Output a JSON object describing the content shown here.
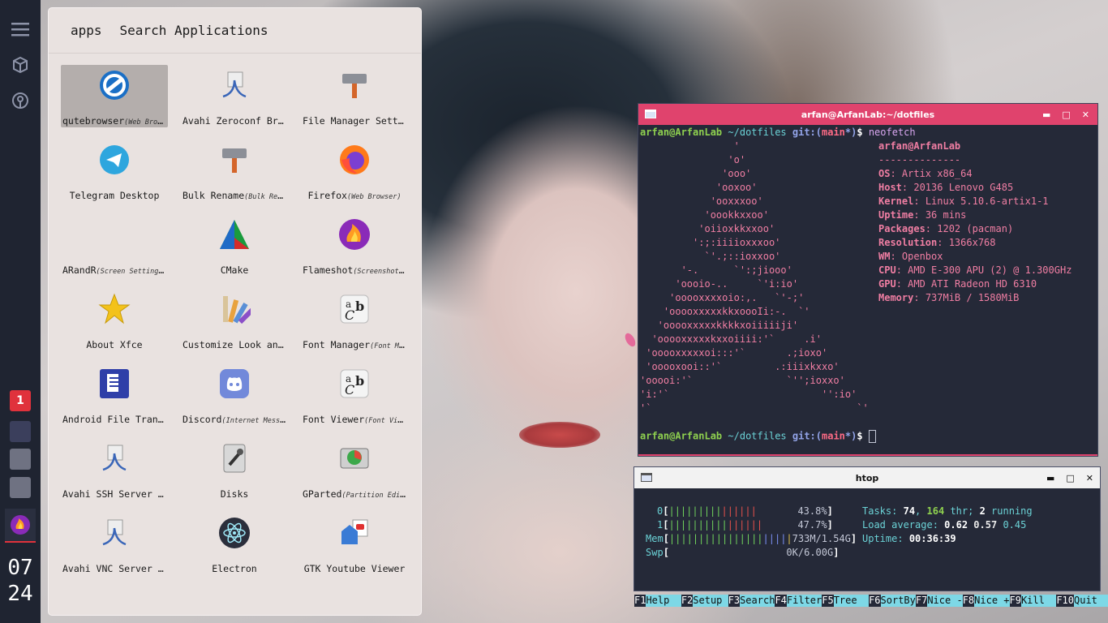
{
  "dock": {
    "icons": [
      "menu-icon",
      "cube-icon",
      "network-icon"
    ],
    "workspace_active": "1",
    "clock_hour": "07",
    "clock_minute": "24"
  },
  "launcher": {
    "mode": "apps",
    "placeholder": "Search Applications",
    "apps": [
      {
        "name": "qutebrowser",
        "cat": "(Web Browser)",
        "icon": "qutebrowser-icon",
        "selected": true
      },
      {
        "name": "Avahi Zeroconf Browser",
        "cat": "",
        "icon": "avahi-icon"
      },
      {
        "name": "File Manager Settings",
        "cat": "",
        "icon": "file-manager-settings-icon"
      },
      {
        "name": "Telegram Desktop",
        "cat": "",
        "icon": "telegram-icon"
      },
      {
        "name": "Bulk Rename",
        "cat": "(Bulk Rename)",
        "icon": "bulk-rename-icon"
      },
      {
        "name": "Firefox",
        "cat": "(Web Browser)",
        "icon": "firefox-icon"
      },
      {
        "name": "ARandR",
        "cat": "(Screen Settings)",
        "icon": "arandr-icon"
      },
      {
        "name": "CMake",
        "cat": "",
        "icon": "cmake-icon"
      },
      {
        "name": "Flameshot",
        "cat": "(Screenshot tool)",
        "icon": "flameshot-icon"
      },
      {
        "name": "About Xfce",
        "cat": "",
        "icon": "xfce-star-icon"
      },
      {
        "name": "Customize Look and Feel",
        "cat": "",
        "icon": "customize-look-icon"
      },
      {
        "name": "Font Manager",
        "cat": "(Font Manager)",
        "icon": "font-manager-icon"
      },
      {
        "name": "Android File Transfer",
        "cat": "",
        "icon": "android-file-transfer-icon"
      },
      {
        "name": "Discord",
        "cat": "(Internet Messenger)",
        "icon": "discord-icon"
      },
      {
        "name": "Font Viewer",
        "cat": "(Font Viewer)",
        "icon": "font-viewer-icon"
      },
      {
        "name": "Avahi SSH Server Browser",
        "cat": "",
        "icon": "avahi-ssh-icon"
      },
      {
        "name": "Disks",
        "cat": "",
        "icon": "disks-icon"
      },
      {
        "name": "GParted",
        "cat": "(Partition Editor)",
        "icon": "gparted-icon"
      },
      {
        "name": "Avahi VNC Server Browser",
        "cat": "",
        "icon": "avahi-vnc-icon"
      },
      {
        "name": "Electron",
        "cat": "",
        "icon": "electron-icon"
      },
      {
        "name": "GTK Youtube Viewer",
        "cat": "",
        "icon": "youtube-viewer-icon"
      }
    ]
  },
  "neofetch": {
    "title": "arfan@ArfanLab:~/dotfiles",
    "prompt_user": "arfan@ArfanLab",
    "prompt_dir": "~/dotfiles",
    "prompt_git": "git:(",
    "prompt_branch": "main",
    "prompt_tail": "*)",
    "prompt_sign": "$",
    "command": "neofetch",
    "art": "                '\n               'o'\n              'ooo'\n             'ooxoo'\n            'ooxxxoo'\n           'oookkxxoo'\n          'oiioxkkxxoo'\n         ':;:iiiioxxxoo'\n           `'.;::ioxxoo'\n       '-.      `':;jiooo'\n      'oooio-..     `'i:io'\n     'ooooxxxxoio:,.   `'-;'\n    'ooooxxxxxkkxoooIi:-.  `'\n   'ooooxxxxxkkkkxoiiiiiji'\n  'ooooxxxxxkxxoiiii:'`     .i'\n 'ooooxxxxxoi:::'`       .;ioxo'\n 'ooooxooi::'`         .:iiixkxxo'\n'ooooi:'`                `'';ioxxo'\n'i:'`                          '':io'\n'`                                   `'",
    "info_header": "arfan@ArfanLab",
    "separator": "--------------",
    "info": [
      {
        "k": "OS",
        "v": "Artix x86_64"
      },
      {
        "k": "Host",
        "v": "20136 Lenovo G485"
      },
      {
        "k": "Kernel",
        "v": "Linux 5.10.6-artix1-1"
      },
      {
        "k": "Uptime",
        "v": "36 mins"
      },
      {
        "k": "Packages",
        "v": "1202 (pacman)"
      },
      {
        "k": "Resolution",
        "v": "1366x768"
      },
      {
        "k": "WM",
        "v": "Openbox"
      },
      {
        "k": "CPU",
        "v": "AMD E-300 APU (2) @ 1.300GHz"
      },
      {
        "k": "GPU",
        "v": "AMD ATI Radeon HD 6310"
      },
      {
        "k": "Memory",
        "v": "737MiB / 1580MiB"
      }
    ]
  },
  "htop": {
    "title": "htop",
    "cpu0_label": "0",
    "cpu0_pct": "43.8%",
    "cpu0_fill": 0.438,
    "cpu1_label": "1",
    "cpu1_pct": "47.7%",
    "cpu1_fill": 0.477,
    "mem_label": "Mem",
    "mem_val": "733M/1.54G",
    "swp_label": "Swp",
    "swp_val": "0K/6.00G",
    "tasks_label": "Tasks:",
    "tasks": "74",
    "thr": "164",
    "thr_label": "thr;",
    "running": "2",
    "running_label": "running",
    "load_label": "Load average:",
    "load1": "0.62",
    "load5": "0.57",
    "load15": "0.45",
    "uptime_label": "Uptime:",
    "uptime": "00:36:39",
    "fkeys": [
      {
        "n": "F1",
        "l": "Help  "
      },
      {
        "n": "F2",
        "l": "Setup "
      },
      {
        "n": "F3",
        "l": "Search"
      },
      {
        "n": "F4",
        "l": "Filter"
      },
      {
        "n": "F5",
        "l": "Tree  "
      },
      {
        "n": "F6",
        "l": "SortBy"
      },
      {
        "n": "F7",
        "l": "Nice -"
      },
      {
        "n": "F8",
        "l": "Nice +"
      },
      {
        "n": "F9",
        "l": "Kill  "
      },
      {
        "n": "F10",
        "l": "Quit  "
      }
    ]
  }
}
